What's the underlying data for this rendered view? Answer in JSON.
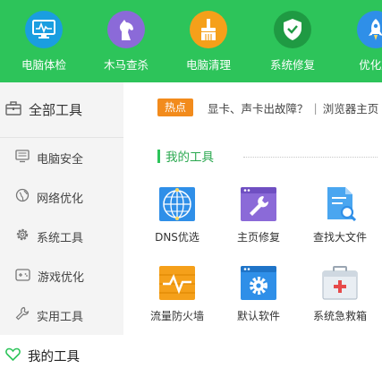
{
  "top_nav": {
    "items": [
      {
        "label": "电脑体检",
        "icon": "monitor-check-icon",
        "color": "#1a9ee0"
      },
      {
        "label": "木马查杀",
        "icon": "horse-icon",
        "color": "#8b6ad8"
      },
      {
        "label": "电脑清理",
        "icon": "broom-icon",
        "color": "#f5a01a"
      },
      {
        "label": "系统修复",
        "icon": "shield-icon",
        "color": "#1f9a43"
      },
      {
        "label": "优化加",
        "icon": "rocket-icon",
        "color": "#2f8fe8"
      }
    ]
  },
  "sidebar": {
    "header": "全部工具",
    "items": [
      {
        "label": "电脑安全",
        "icon": "monitor-icon"
      },
      {
        "label": "网络优化",
        "icon": "globe-icon"
      },
      {
        "label": "系统工具",
        "icon": "gear-icon"
      },
      {
        "label": "游戏优化",
        "icon": "gamepad-icon"
      },
      {
        "label": "实用工具",
        "icon": "wrench-icon"
      }
    ],
    "my_tools": "我的工具"
  },
  "main": {
    "hot_badge": "热点",
    "notice_text": "显卡、声卡出故障？",
    "notice_sep": "|",
    "notice_text2": "浏览器主页",
    "section_title": "我的工具",
    "tools": [
      {
        "label": "DNS优选",
        "icon": "dns-globe-icon"
      },
      {
        "label": "主页修复",
        "icon": "wrench-window-icon"
      },
      {
        "label": "查找大文件",
        "icon": "file-search-icon"
      },
      {
        "label": "流量防火墙",
        "icon": "traffic-firewall-icon"
      },
      {
        "label": "默认软件",
        "icon": "default-software-gear-icon"
      },
      {
        "label": "系统急救箱",
        "icon": "first-aid-kit-icon"
      }
    ]
  },
  "colors": {
    "brand_green": "#2dc45a",
    "hot_orange": "#f28b1c",
    "sidebar_bg": "#f4f4f4"
  }
}
